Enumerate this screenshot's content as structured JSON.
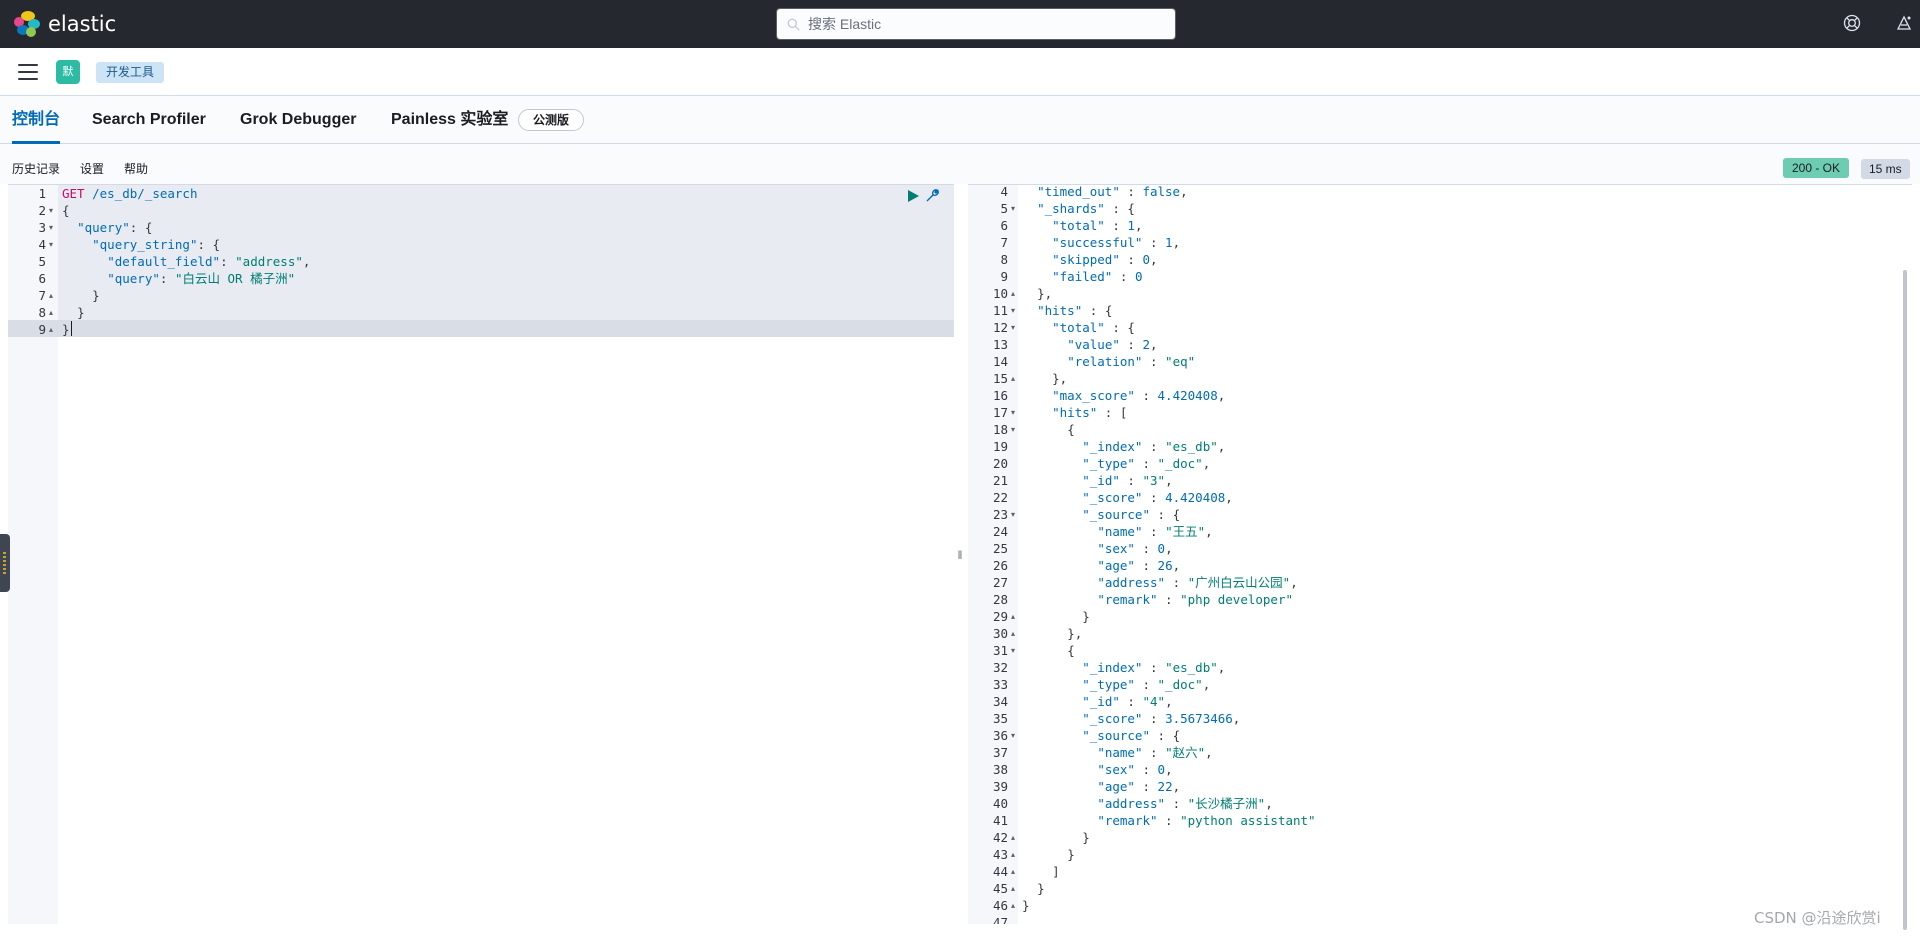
{
  "header": {
    "brand": "elastic",
    "search_placeholder": "搜索 Elastic",
    "icons": [
      "help-icon",
      "newsfeed-icon"
    ]
  },
  "subbar": {
    "space_initial": "默",
    "breadcrumb": "开发工具"
  },
  "tabs": [
    {
      "label": "控制台",
      "active": true
    },
    {
      "label": "Search Profiler",
      "active": false
    },
    {
      "label": "Grok Debugger",
      "active": false
    },
    {
      "label": "Painless 实验室",
      "active": false
    }
  ],
  "beta_badge": "公测版",
  "console_menu": {
    "history": "历史记录",
    "settings": "设置",
    "help": "帮助"
  },
  "status": {
    "code": "200 - OK",
    "time": "15 ms"
  },
  "request_editor": {
    "lines": [
      {
        "n": "1",
        "fold": "",
        "text": "GET /es_db/_search"
      },
      {
        "n": "2",
        "fold": "▾",
        "text": "{"
      },
      {
        "n": "3",
        "fold": "▾",
        "text": "  \"query\": {"
      },
      {
        "n": "4",
        "fold": "▾",
        "text": "    \"query_string\": {"
      },
      {
        "n": "5",
        "fold": "",
        "text": "      \"default_field\": \"address\","
      },
      {
        "n": "6",
        "fold": "",
        "text": "      \"query\": \"白云山 OR 橘子洲\""
      },
      {
        "n": "7",
        "fold": "▴",
        "text": "    }"
      },
      {
        "n": "8",
        "fold": "▴",
        "text": "  }"
      },
      {
        "n": "9",
        "fold": "▴",
        "text": "}"
      }
    ]
  },
  "response_editor": {
    "lines": [
      {
        "n": "4",
        "fold": "",
        "text": "  \"timed_out\" : false,"
      },
      {
        "n": "5",
        "fold": "▾",
        "text": "  \"_shards\" : {"
      },
      {
        "n": "6",
        "fold": "",
        "text": "    \"total\" : 1,"
      },
      {
        "n": "7",
        "fold": "",
        "text": "    \"successful\" : 1,"
      },
      {
        "n": "8",
        "fold": "",
        "text": "    \"skipped\" : 0,"
      },
      {
        "n": "9",
        "fold": "",
        "text": "    \"failed\" : 0"
      },
      {
        "n": "10",
        "fold": "▴",
        "text": "  },"
      },
      {
        "n": "11",
        "fold": "▾",
        "text": "  \"hits\" : {"
      },
      {
        "n": "12",
        "fold": "▾",
        "text": "    \"total\" : {"
      },
      {
        "n": "13",
        "fold": "",
        "text": "      \"value\" : 2,"
      },
      {
        "n": "14",
        "fold": "",
        "text": "      \"relation\" : \"eq\""
      },
      {
        "n": "15",
        "fold": "▴",
        "text": "    },"
      },
      {
        "n": "16",
        "fold": "",
        "text": "    \"max_score\" : 4.420408,"
      },
      {
        "n": "17",
        "fold": "▾",
        "text": "    \"hits\" : ["
      },
      {
        "n": "18",
        "fold": "▾",
        "text": "      {"
      },
      {
        "n": "19",
        "fold": "",
        "text": "        \"_index\" : \"es_db\","
      },
      {
        "n": "20",
        "fold": "",
        "text": "        \"_type\" : \"_doc\","
      },
      {
        "n": "21",
        "fold": "",
        "text": "        \"_id\" : \"3\","
      },
      {
        "n": "22",
        "fold": "",
        "text": "        \"_score\" : 4.420408,"
      },
      {
        "n": "23",
        "fold": "▾",
        "text": "        \"_source\" : {"
      },
      {
        "n": "24",
        "fold": "",
        "text": "          \"name\" : \"王五\","
      },
      {
        "n": "25",
        "fold": "",
        "text": "          \"sex\" : 0,"
      },
      {
        "n": "26",
        "fold": "",
        "text": "          \"age\" : 26,"
      },
      {
        "n": "27",
        "fold": "",
        "text": "          \"address\" : \"广州白云山公园\","
      },
      {
        "n": "28",
        "fold": "",
        "text": "          \"remark\" : \"php developer\""
      },
      {
        "n": "29",
        "fold": "▴",
        "text": "        }"
      },
      {
        "n": "30",
        "fold": "▴",
        "text": "      },"
      },
      {
        "n": "31",
        "fold": "▾",
        "text": "      {"
      },
      {
        "n": "32",
        "fold": "",
        "text": "        \"_index\" : \"es_db\","
      },
      {
        "n": "33",
        "fold": "",
        "text": "        \"_type\" : \"_doc\","
      },
      {
        "n": "34",
        "fold": "",
        "text": "        \"_id\" : \"4\","
      },
      {
        "n": "35",
        "fold": "",
        "text": "        \"_score\" : 3.5673466,"
      },
      {
        "n": "36",
        "fold": "▾",
        "text": "        \"_source\" : {"
      },
      {
        "n": "37",
        "fold": "",
        "text": "          \"name\" : \"赵六\","
      },
      {
        "n": "38",
        "fold": "",
        "text": "          \"sex\" : 0,"
      },
      {
        "n": "39",
        "fold": "",
        "text": "          \"age\" : 22,"
      },
      {
        "n": "40",
        "fold": "",
        "text": "          \"address\" : \"长沙橘子洲\","
      },
      {
        "n": "41",
        "fold": "",
        "text": "          \"remark\" : \"python assistant\""
      },
      {
        "n": "42",
        "fold": "▴",
        "text": "        }"
      },
      {
        "n": "43",
        "fold": "▴",
        "text": "      }"
      },
      {
        "n": "44",
        "fold": "▴",
        "text": "    ]"
      },
      {
        "n": "45",
        "fold": "▴",
        "text": "  }"
      },
      {
        "n": "46",
        "fold": "▴",
        "text": "}"
      },
      {
        "n": "47",
        "fold": "",
        "text": ""
      }
    ]
  },
  "watermark": "CSDN @沿途欣赏i",
  "colors": {
    "header_bg": "#25282f",
    "accent": "#006bb8",
    "status_ok": "#6dccb1",
    "string": "#017d73",
    "method": "#c80a68"
  }
}
